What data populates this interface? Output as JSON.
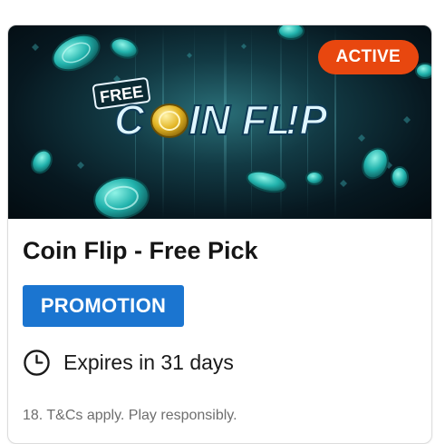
{
  "promo": {
    "banner": {
      "badge_free": "FREE",
      "logo_text": "COIN FLIP",
      "logo_part1": "C",
      "logo_part2": "IN FL",
      "logo_part3": "!P"
    },
    "status_badge": "ACTIVE",
    "title": "Coin Flip - Free Pick",
    "category_tag": "PROMOTION",
    "expiry": {
      "icon": "clock-icon",
      "text": "Expires in 31 days"
    },
    "footer_text": "18. T&Cs apply. Play responsibly."
  },
  "colors": {
    "active_badge": "#e8470f",
    "promotion_tag": "#1b75d0",
    "chip_teal": "#2fc6c0"
  }
}
